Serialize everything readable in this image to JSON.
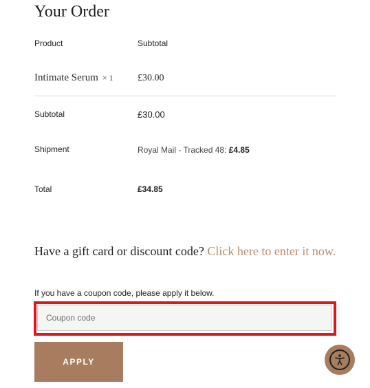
{
  "page_title": "Your Order",
  "order_table": {
    "header_product": "Product",
    "header_subtotal": "Subtotal",
    "item": {
      "name": "Intimate Serum",
      "qty": "× 1",
      "price": "£30.00"
    },
    "subtotal_label": "Subtotal",
    "subtotal_value": "£30.00",
    "shipment_label": "Shipment",
    "shipment_method": "Royal Mail - Tracked 48: ",
    "shipment_price": "£4.85",
    "total_label": "Total",
    "total_value": "£34.85"
  },
  "gift": {
    "heading": "Have a gift card or discount code? ",
    "link": "Click here to enter it now."
  },
  "coupon": {
    "help_text": "If you have a coupon code, please apply it below.",
    "placeholder": "Coupon code",
    "value": "",
    "apply_label": "APPLY"
  },
  "icons": {
    "accessibility": "accessibility-icon"
  },
  "colors": {
    "accent": "#a87c5f",
    "link": "#b68d70",
    "highlight_border": "#e0161f"
  }
}
